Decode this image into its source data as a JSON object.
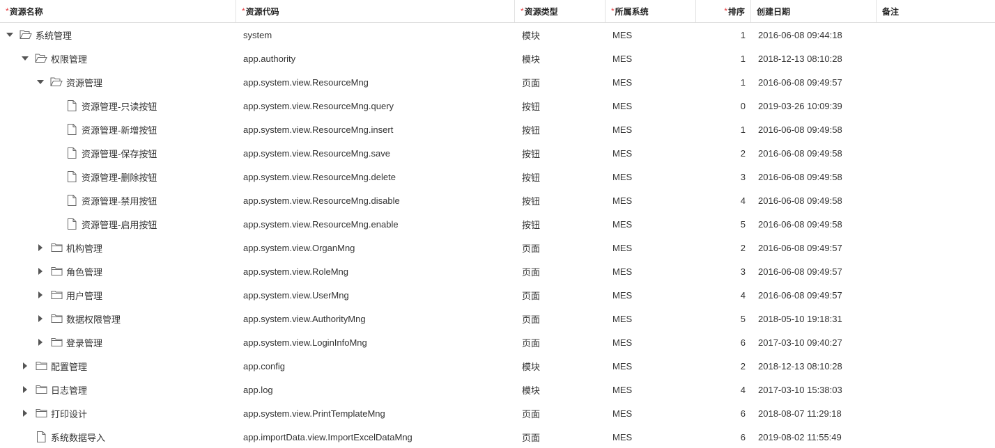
{
  "columns": [
    {
      "label": "资源名称",
      "required": true
    },
    {
      "label": "资源代码",
      "required": true
    },
    {
      "label": "资源类型",
      "required": true
    },
    {
      "label": "所属系统",
      "required": true
    },
    {
      "label": "排序",
      "required": true
    },
    {
      "label": "创建日期",
      "required": false
    },
    {
      "label": "备注",
      "required": false
    }
  ],
  "required_marker": "*",
  "rows": [
    {
      "level": 0,
      "toggle": "expanded",
      "icon": "folder-open-icon",
      "name": "系统管理",
      "code": "system",
      "type": "模块",
      "system": "MES",
      "order": "1",
      "date": "2016-06-08 09:44:18",
      "note": ""
    },
    {
      "level": 1,
      "toggle": "expanded",
      "icon": "folder-open-icon",
      "name": "权限管理",
      "code": "app.authority",
      "type": "模块",
      "system": "MES",
      "order": "1",
      "date": "2018-12-13 08:10:28",
      "note": ""
    },
    {
      "level": 2,
      "toggle": "expanded",
      "icon": "folder-open-icon",
      "name": "资源管理",
      "code": "app.system.view.ResourceMng",
      "type": "页面",
      "system": "MES",
      "order": "1",
      "date": "2016-06-08 09:49:57",
      "note": ""
    },
    {
      "level": 3,
      "toggle": "none",
      "icon": "file-icon",
      "name": "资源管理-只读按钮",
      "code": "app.system.view.ResourceMng.query",
      "type": "按钮",
      "system": "MES",
      "order": "0",
      "date": "2019-03-26 10:09:39",
      "note": ""
    },
    {
      "level": 3,
      "toggle": "none",
      "icon": "file-icon",
      "name": "资源管理-新增按钮",
      "code": "app.system.view.ResourceMng.insert",
      "type": "按钮",
      "system": "MES",
      "order": "1",
      "date": "2016-06-08 09:49:58",
      "note": ""
    },
    {
      "level": 3,
      "toggle": "none",
      "icon": "file-icon",
      "name": "资源管理-保存按钮",
      "code": "app.system.view.ResourceMng.save",
      "type": "按钮",
      "system": "MES",
      "order": "2",
      "date": "2016-06-08 09:49:58",
      "note": ""
    },
    {
      "level": 3,
      "toggle": "none",
      "icon": "file-icon",
      "name": "资源管理-删除按钮",
      "code": "app.system.view.ResourceMng.delete",
      "type": "按钮",
      "system": "MES",
      "order": "3",
      "date": "2016-06-08 09:49:58",
      "note": ""
    },
    {
      "level": 3,
      "toggle": "none",
      "icon": "file-icon",
      "name": "资源管理-禁用按钮",
      "code": "app.system.view.ResourceMng.disable",
      "type": "按钮",
      "system": "MES",
      "order": "4",
      "date": "2016-06-08 09:49:58",
      "note": ""
    },
    {
      "level": 3,
      "toggle": "none",
      "icon": "file-icon",
      "name": "资源管理-启用按钮",
      "code": "app.system.view.ResourceMng.enable",
      "type": "按钮",
      "system": "MES",
      "order": "5",
      "date": "2016-06-08 09:49:58",
      "note": ""
    },
    {
      "level": 2,
      "toggle": "collapsed",
      "icon": "folder-icon",
      "name": "机构管理",
      "code": "app.system.view.OrganMng",
      "type": "页面",
      "system": "MES",
      "order": "2",
      "date": "2016-06-08 09:49:57",
      "note": ""
    },
    {
      "level": 2,
      "toggle": "collapsed",
      "icon": "folder-icon",
      "name": "角色管理",
      "code": "app.system.view.RoleMng",
      "type": "页面",
      "system": "MES",
      "order": "3",
      "date": "2016-06-08 09:49:57",
      "note": ""
    },
    {
      "level": 2,
      "toggle": "collapsed",
      "icon": "folder-icon",
      "name": "用户管理",
      "code": "app.system.view.UserMng",
      "type": "页面",
      "system": "MES",
      "order": "4",
      "date": "2016-06-08 09:49:57",
      "note": ""
    },
    {
      "level": 2,
      "toggle": "collapsed",
      "icon": "folder-icon",
      "name": "数据权限管理",
      "code": "app.system.view.AuthorityMng",
      "type": "页面",
      "system": "MES",
      "order": "5",
      "date": "2018-05-10 19:18:31",
      "note": ""
    },
    {
      "level": 2,
      "toggle": "collapsed",
      "icon": "folder-icon",
      "name": "登录管理",
      "code": "app.system.view.LoginInfoMng",
      "type": "页面",
      "system": "MES",
      "order": "6",
      "date": "2017-03-10 09:40:27",
      "note": ""
    },
    {
      "level": 1,
      "toggle": "collapsed",
      "icon": "folder-icon",
      "name": "配置管理",
      "code": "app.config",
      "type": "模块",
      "system": "MES",
      "order": "2",
      "date": "2018-12-13 08:10:28",
      "note": ""
    },
    {
      "level": 1,
      "toggle": "collapsed",
      "icon": "folder-icon",
      "name": "日志管理",
      "code": "app.log",
      "type": "模块",
      "system": "MES",
      "order": "4",
      "date": "2017-03-10 15:38:03",
      "note": ""
    },
    {
      "level": 1,
      "toggle": "collapsed",
      "icon": "folder-icon",
      "name": "打印设计",
      "code": "app.system.view.PrintTemplateMng",
      "type": "页面",
      "system": "MES",
      "order": "6",
      "date": "2018-08-07 11:29:18",
      "note": ""
    },
    {
      "level": 1,
      "toggle": "none",
      "icon": "file-icon",
      "name": "系统数据导入",
      "code": "app.importData.view.ImportExcelDataMng",
      "type": "页面",
      "system": "MES",
      "order": "6",
      "date": "2019-08-02 11:55:49",
      "note": ""
    }
  ],
  "colors": {
    "required": "#e4393c",
    "icon_stroke": "#666666",
    "caret": "#555555"
  }
}
